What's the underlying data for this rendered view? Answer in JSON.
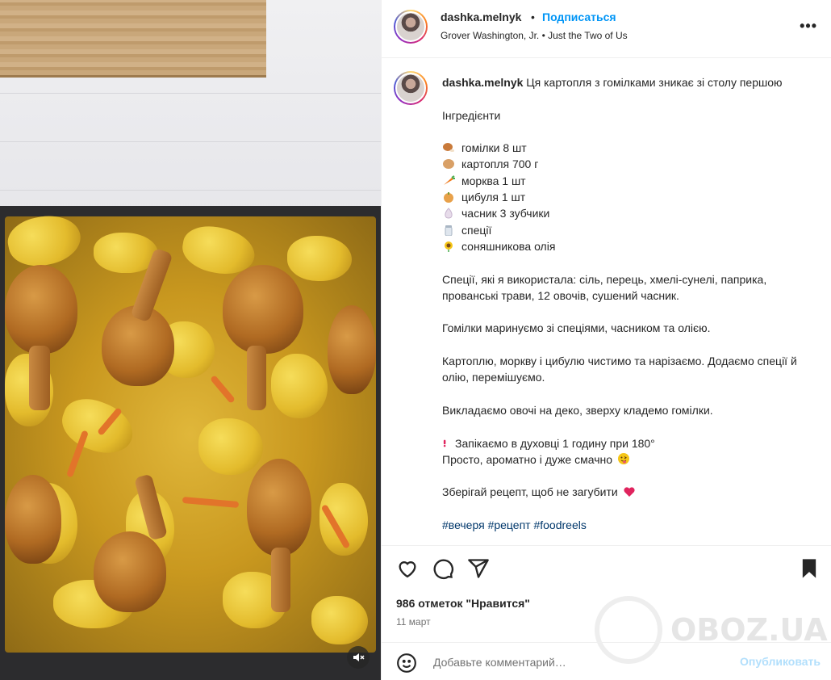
{
  "media": {
    "mute_icon": "volume-muted-icon"
  },
  "header": {
    "username": "dashka.melnyk",
    "separator": "•",
    "follow_label": "Подписаться",
    "audio": "Grover Washington, Jr. • Just the Two of Us",
    "more_icon": "more-options-icon"
  },
  "caption": {
    "username": "dashka.melnyk",
    "lines": [
      "Ця картопля з гомілками зникає зі столу першою",
      "",
      "Інгредієнти",
      "",
      "гомілки 8 шт",
      "картопля 700 г",
      "морква 1 шт",
      "цибуля 1 шт",
      "часник 3 зубчики",
      "спеції",
      "соняшникова олія",
      "",
      "Спеції, які я використала: сіль, перець, хмелі-сунелі, паприка, прованські трави, 12 овочів, сушений часник.",
      "",
      "Гомілки маринуємо зі спеціями, часником та олією.",
      "",
      "Картоплю, моркву і цибулю чистимо та нарізаємо. Додаємо спеції й олію, перемішуємо.",
      "",
      "Викладаємо овочі на деко, зверху кладемо гомілки.",
      "",
      "Запікаємо в духовці 1 годину при 180°",
      "Просто, ароматно і дуже смачно",
      "",
      "Зберігай рецепт, щоб не загубити",
      "",
      "#вечеря #рецепт #foodreels"
    ],
    "ingredient_icons": [
      "drumstick-emoji",
      "potato-emoji",
      "carrot-emoji",
      "onion-emoji",
      "garlic-emoji",
      "salt-emoji",
      "sunflower-emoji"
    ],
    "colors": {
      "hashtag": "#00376b",
      "heart": "#e0245e",
      "exclamation": "#e0245e"
    }
  },
  "actions": {
    "likes": "986 отметок \"Нравится\"",
    "date": "11 март",
    "watermark": "OBOZ.UA"
  },
  "comment": {
    "placeholder": "Добавьте комментарий…",
    "publish_label": "Опубликовать"
  },
  "colors": {
    "accent": "#0095f6",
    "publish_disabled": "#b2dffc"
  }
}
